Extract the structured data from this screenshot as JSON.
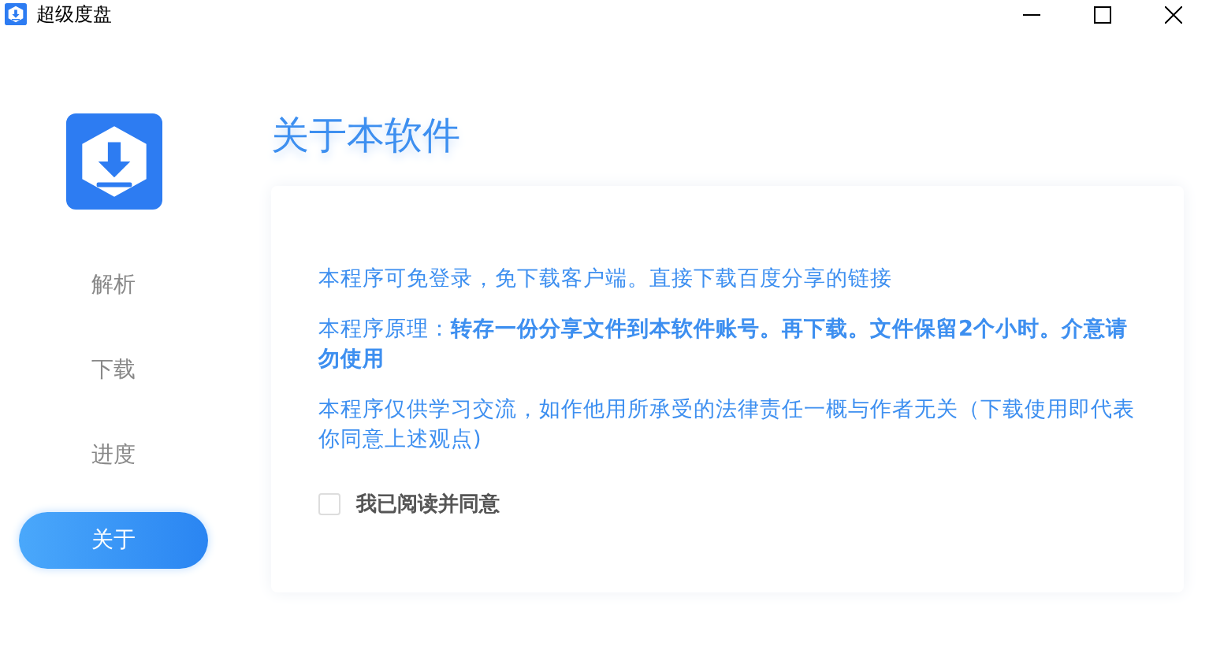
{
  "window": {
    "title": "超级度盘"
  },
  "sidebar": {
    "items": [
      {
        "label": "解析",
        "selected": false
      },
      {
        "label": "下载",
        "selected": false
      },
      {
        "label": "进度",
        "selected": false
      },
      {
        "label": "关于",
        "selected": true
      }
    ]
  },
  "heading": "关于本软件",
  "paragraphs": [
    "本程序可免登录，免下载客户端。直接下载百度分享的链接",
    "本程序原理：**转存一份分享文件到本软件账号。再下载。文件保留2个小时。介意请勿使用**",
    "本程序仅供学习交流，如作他用所承受的法律责任一概与作者无关（下载使用即代表你同意上述观点)"
  ],
  "agree": {
    "label": "我已阅读并同意",
    "checked": false
  }
}
